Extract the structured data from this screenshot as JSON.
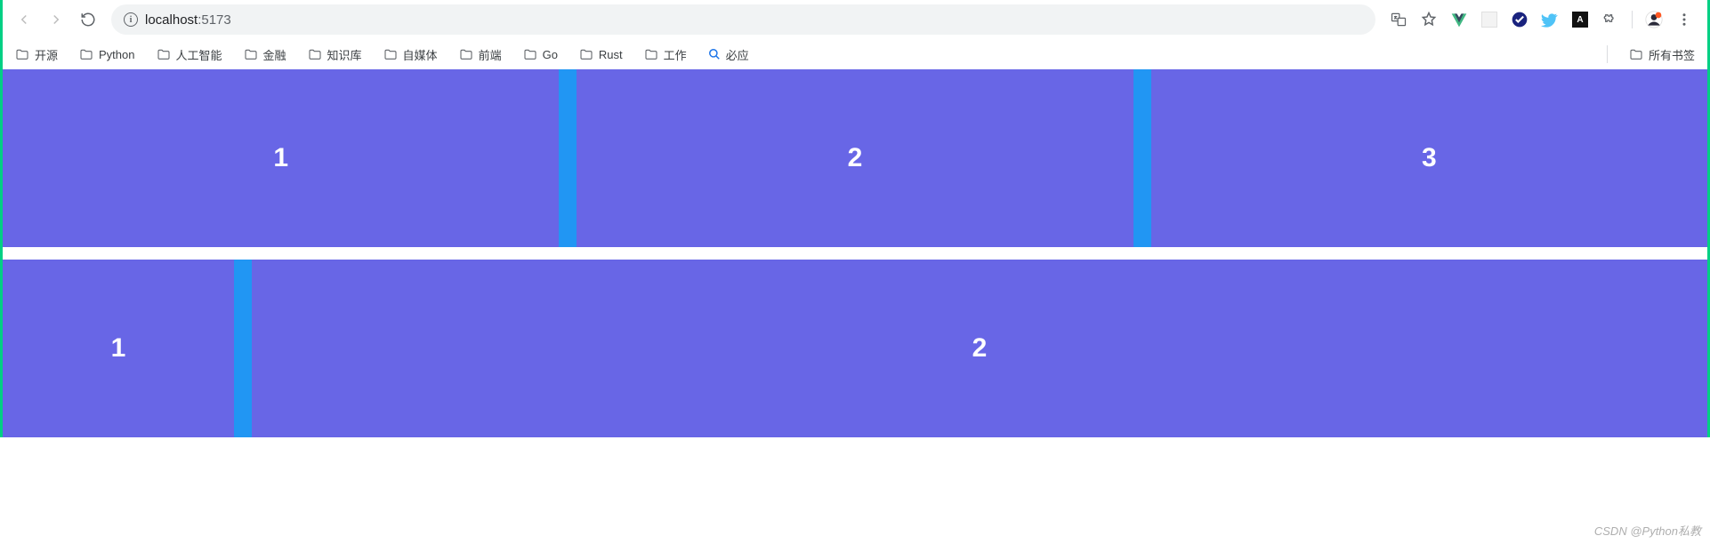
{
  "toolbar": {
    "url_host": "localhost",
    "url_port": ":5173"
  },
  "bookmarks": {
    "items": [
      "开源",
      "Python",
      "人工智能",
      "金融",
      "知识库",
      "自媒体",
      "前端",
      "Go",
      "Rust",
      "工作"
    ],
    "search_label": "必应",
    "all_bookmarks": "所有书签"
  },
  "grid": {
    "row1": [
      "1",
      "2",
      "3"
    ],
    "row2": [
      "1",
      "2"
    ]
  },
  "watermark": "CSDN @Python私教",
  "colors": {
    "cell": "#6866e6",
    "gap": "#2196f3",
    "accent": "#00d084"
  }
}
